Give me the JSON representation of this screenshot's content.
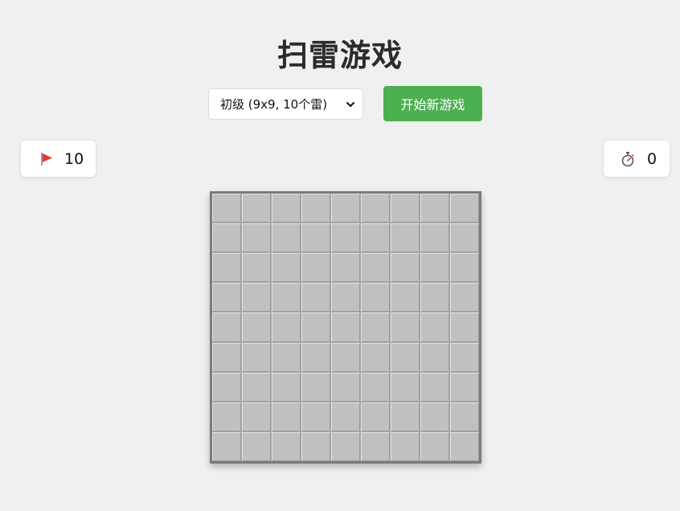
{
  "title": "扫雷游戏",
  "controls": {
    "difficulty_selected": "初级 (9x9, 10个雷)",
    "new_game_label": "开始新游戏"
  },
  "stats": {
    "flags_icon": "red-flag-icon",
    "flags_remaining": "10",
    "timer_icon": "stopwatch-icon",
    "timer_value": "0"
  },
  "board": {
    "rows": 9,
    "cols": 9,
    "cell_state": "unrevealed"
  },
  "colors": {
    "accent": "#4caf50",
    "background": "#f0f0f0",
    "cell": "#c0c0c0",
    "flag": "#e53935"
  }
}
